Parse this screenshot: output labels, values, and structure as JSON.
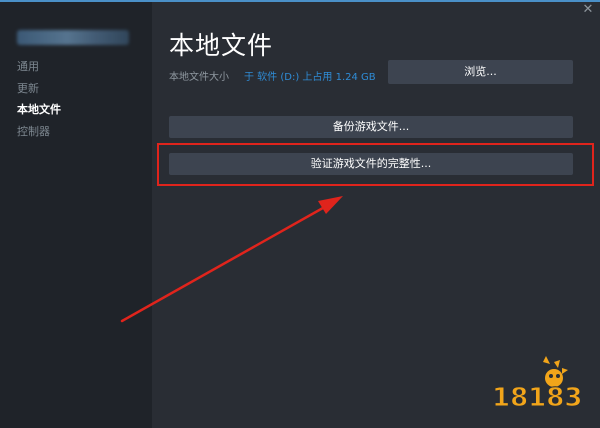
{
  "sidebar": {
    "items": [
      {
        "label": "通用"
      },
      {
        "label": "更新"
      },
      {
        "label": "本地文件",
        "active": true
      },
      {
        "label": "控制器"
      }
    ]
  },
  "main": {
    "title": "本地文件",
    "size_label": "本地文件大小",
    "size_value": "于 软件 (D:) 上占用 1.24 GB",
    "browse_label": "浏览...",
    "backup_label": "备份游戏文件...",
    "verify_label": "验证游戏文件的完整性...",
    "close_glyph": "✕"
  },
  "watermark": {
    "text": "18183"
  },
  "colors": {
    "accent_link": "#2f8cd6",
    "highlight": "#e0241c",
    "button_bg": "#3d4450",
    "watermark": "#f2a51a"
  }
}
